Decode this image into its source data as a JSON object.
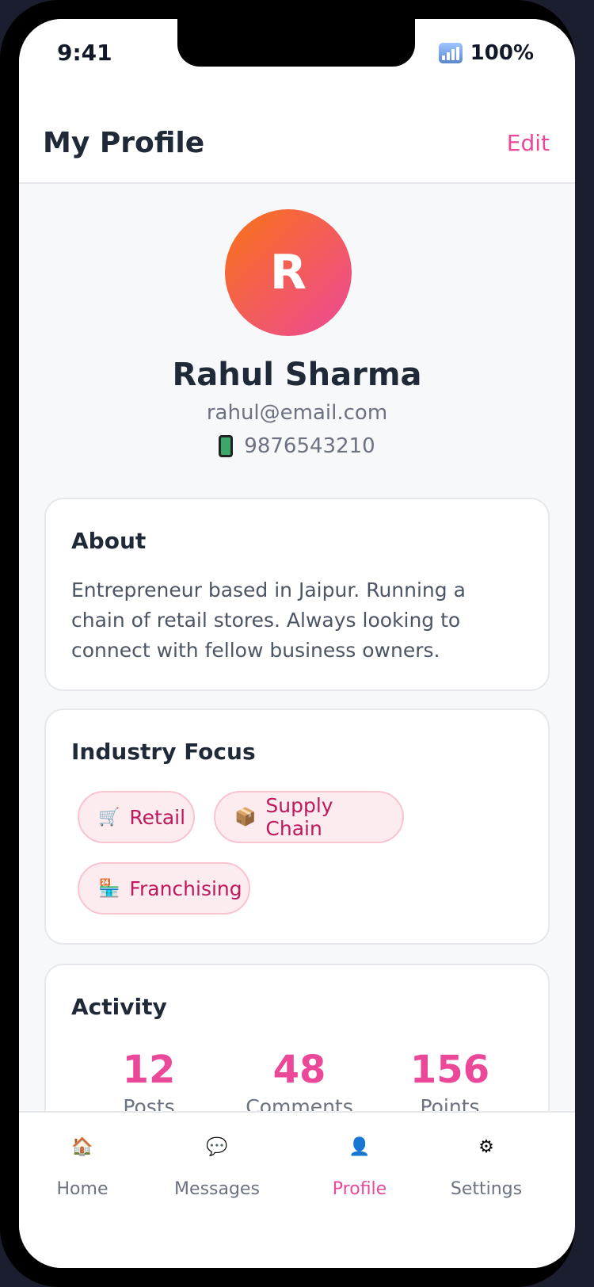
{
  "status_bar": {
    "time": "9:41",
    "battery": "100%",
    "signal_icon": "signal-icon"
  },
  "header": {
    "title": "My Profile",
    "edit_label": "Edit"
  },
  "profile": {
    "avatar_initial": "R",
    "name": "Rahul Sharma",
    "email": "rahul@email.com",
    "phone": "9876543210",
    "phone_icon": "mobile-phone-icon"
  },
  "about": {
    "title": "About",
    "text": "Entrepreneur based in Jaipur. Running a chain of retail stores. Always looking to connect with fellow business owners."
  },
  "industry": {
    "title": "Industry Focus",
    "tags": [
      {
        "icon": "🛒",
        "label": "Retail"
      },
      {
        "icon": "📦",
        "label": "Supply Chain"
      },
      {
        "icon": "🏪",
        "label": "Franchising"
      }
    ]
  },
  "activity": {
    "title": "Activity",
    "stats": [
      {
        "value": "12",
        "label": "Posts"
      },
      {
        "value": "48",
        "label": "Comments"
      },
      {
        "value": "156",
        "label": "Points"
      }
    ]
  },
  "tab_bar": {
    "items": [
      {
        "icon": "🏠",
        "label": "Home"
      },
      {
        "icon": "💬",
        "label": "Messages"
      },
      {
        "icon": "👤",
        "label": "Profile"
      },
      {
        "icon": "⚙",
        "label": "Settings"
      }
    ],
    "active": "Profile"
  },
  "colors": {
    "accent": "#ec4899",
    "gradient_start": "#f97316",
    "gradient_end": "#ec4899",
    "text_dark": "#1f2937",
    "text_muted": "#6b7280"
  }
}
